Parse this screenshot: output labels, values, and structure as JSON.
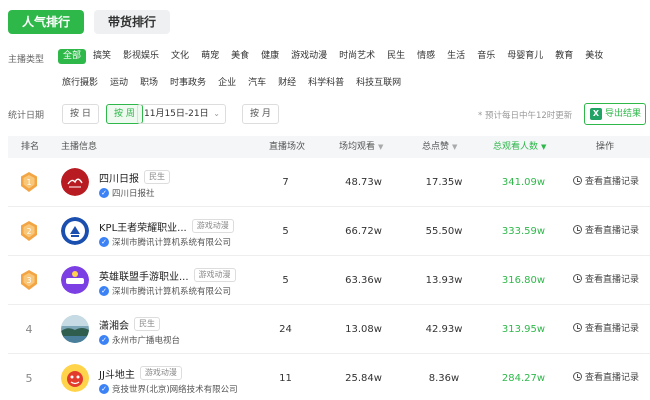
{
  "tabs": [
    {
      "label": "人气排行",
      "active": true
    },
    {
      "label": "带货排行",
      "active": false
    }
  ],
  "filters": {
    "category_label": "主播类型",
    "categories_row1": [
      "全部",
      "搞笑",
      "影视娱乐",
      "文化",
      "萌宠",
      "美食",
      "健康",
      "游戏动漫",
      "时尚艺术",
      "民生",
      "情感",
      "生活",
      "音乐",
      "母婴育儿",
      "教育",
      "美妆"
    ],
    "categories_row2": [
      "旅行摄影",
      "运动",
      "职场",
      "时事政务",
      "企业",
      "汽车",
      "财经",
      "科学科普",
      "科技互联网"
    ],
    "active_category": "全部"
  },
  "date_filter": {
    "label": "统计日期",
    "by_day": "按 日",
    "by_week": "按 周",
    "week_value": "11月15日-21日",
    "by_month": "按 月",
    "note": "* 预计每日中午12时更新",
    "export_label": "导出结果"
  },
  "columns": {
    "rank": "排名",
    "host": "主播信息",
    "sessions": "直播场次",
    "avg_views": "场均观看",
    "likes": "总点赞",
    "total_viewers": "总观看人数",
    "action": "操作"
  },
  "rows": [
    {
      "rank": "1",
      "name": "四川日报",
      "tag": "民生",
      "org": "四川日报社",
      "sessions": "7",
      "avg_views": "48.73w",
      "likes": "17.35w",
      "total": "341.09w",
      "action": "查看直播记录"
    },
    {
      "rank": "2",
      "name": "KPL王者荣耀职业...",
      "tag": "游戏动漫",
      "org": "深圳市腾讯计算机系统有限公司",
      "sessions": "5",
      "avg_views": "66.72w",
      "likes": "55.50w",
      "total": "333.59w",
      "action": "查看直播记录"
    },
    {
      "rank": "3",
      "name": "英雄联盟手游职业...",
      "tag": "游戏动漫",
      "org": "深圳市腾讯计算机系统有限公司",
      "sessions": "5",
      "avg_views": "63.36w",
      "likes": "13.93w",
      "total": "316.80w",
      "action": "查看直播记录"
    },
    {
      "rank": "4",
      "name": "潇湘会",
      "tag": "民生",
      "org": "永州市广播电视台",
      "sessions": "24",
      "avg_views": "13.08w",
      "likes": "42.93w",
      "total": "313.95w",
      "action": "查看直播记录"
    },
    {
      "rank": "5",
      "name": "JJ斗地主",
      "tag": "游戏动漫",
      "org": "竞技世界(北京)网络技术有限公司",
      "sessions": "11",
      "avg_views": "25.84w",
      "likes": "8.36w",
      "total": "284.27w",
      "action": "查看直播记录"
    }
  ],
  "colors": {
    "accent": "#2fb84a",
    "medal": "#f3a544"
  },
  "icons": {
    "export": "excel-icon",
    "verify": "verified-icon",
    "action": "clock-icon",
    "rank_badge": "medal-icon"
  }
}
